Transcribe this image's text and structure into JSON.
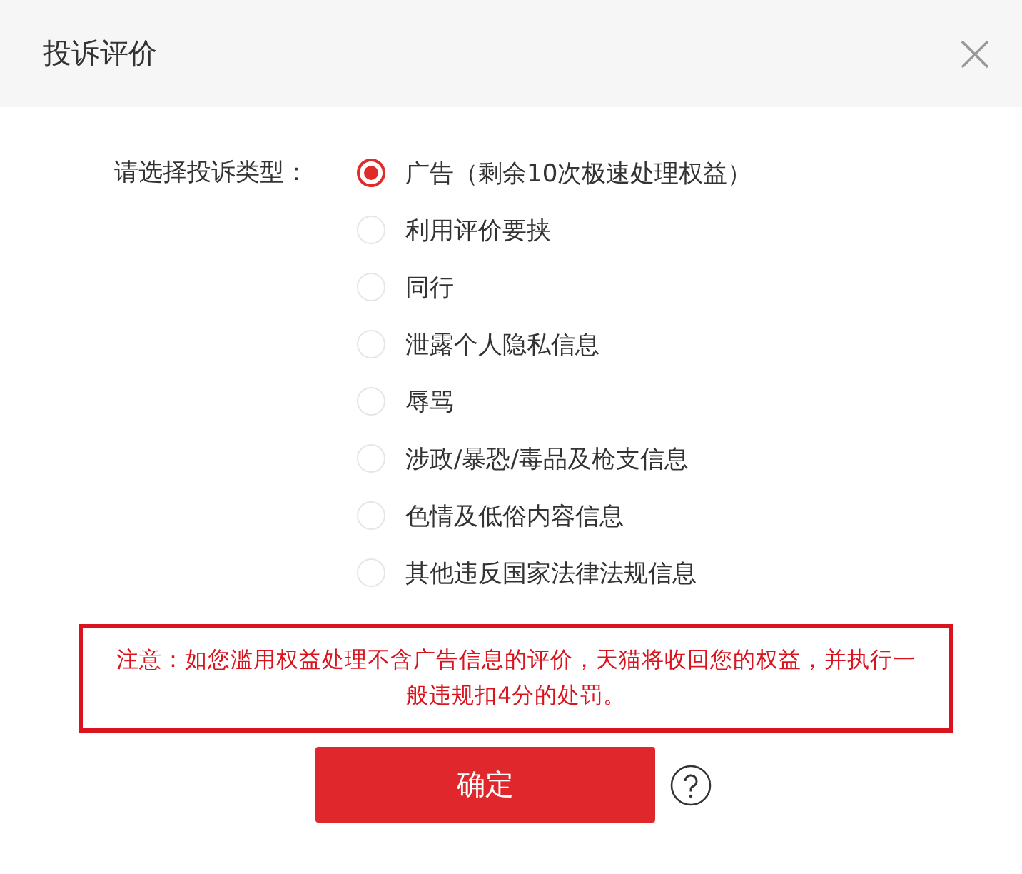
{
  "window": {
    "title": "投诉评价"
  },
  "complaint_type": {
    "label": "请选择投诉类型：",
    "options": [
      {
        "label": "广告（剩余10次极速处理权益）",
        "selected": true
      },
      {
        "label": "利用评价要挟",
        "selected": false
      },
      {
        "label": "同行",
        "selected": false
      },
      {
        "label": "泄露个人隐私信息",
        "selected": false
      },
      {
        "label": "辱骂",
        "selected": false
      },
      {
        "label": "涉政/暴恐/毒品及枪支信息",
        "selected": false
      },
      {
        "label": "色情及低俗内容信息",
        "selected": false
      },
      {
        "label": "其他违反国家法律法规信息",
        "selected": false
      }
    ]
  },
  "notice": "注意：如您滥用权益处理不含广告信息的评价，天猫将收回您的权益，并执行一般违规扣4分的处罚。",
  "buttons": [
    "确定"
  ]
}
